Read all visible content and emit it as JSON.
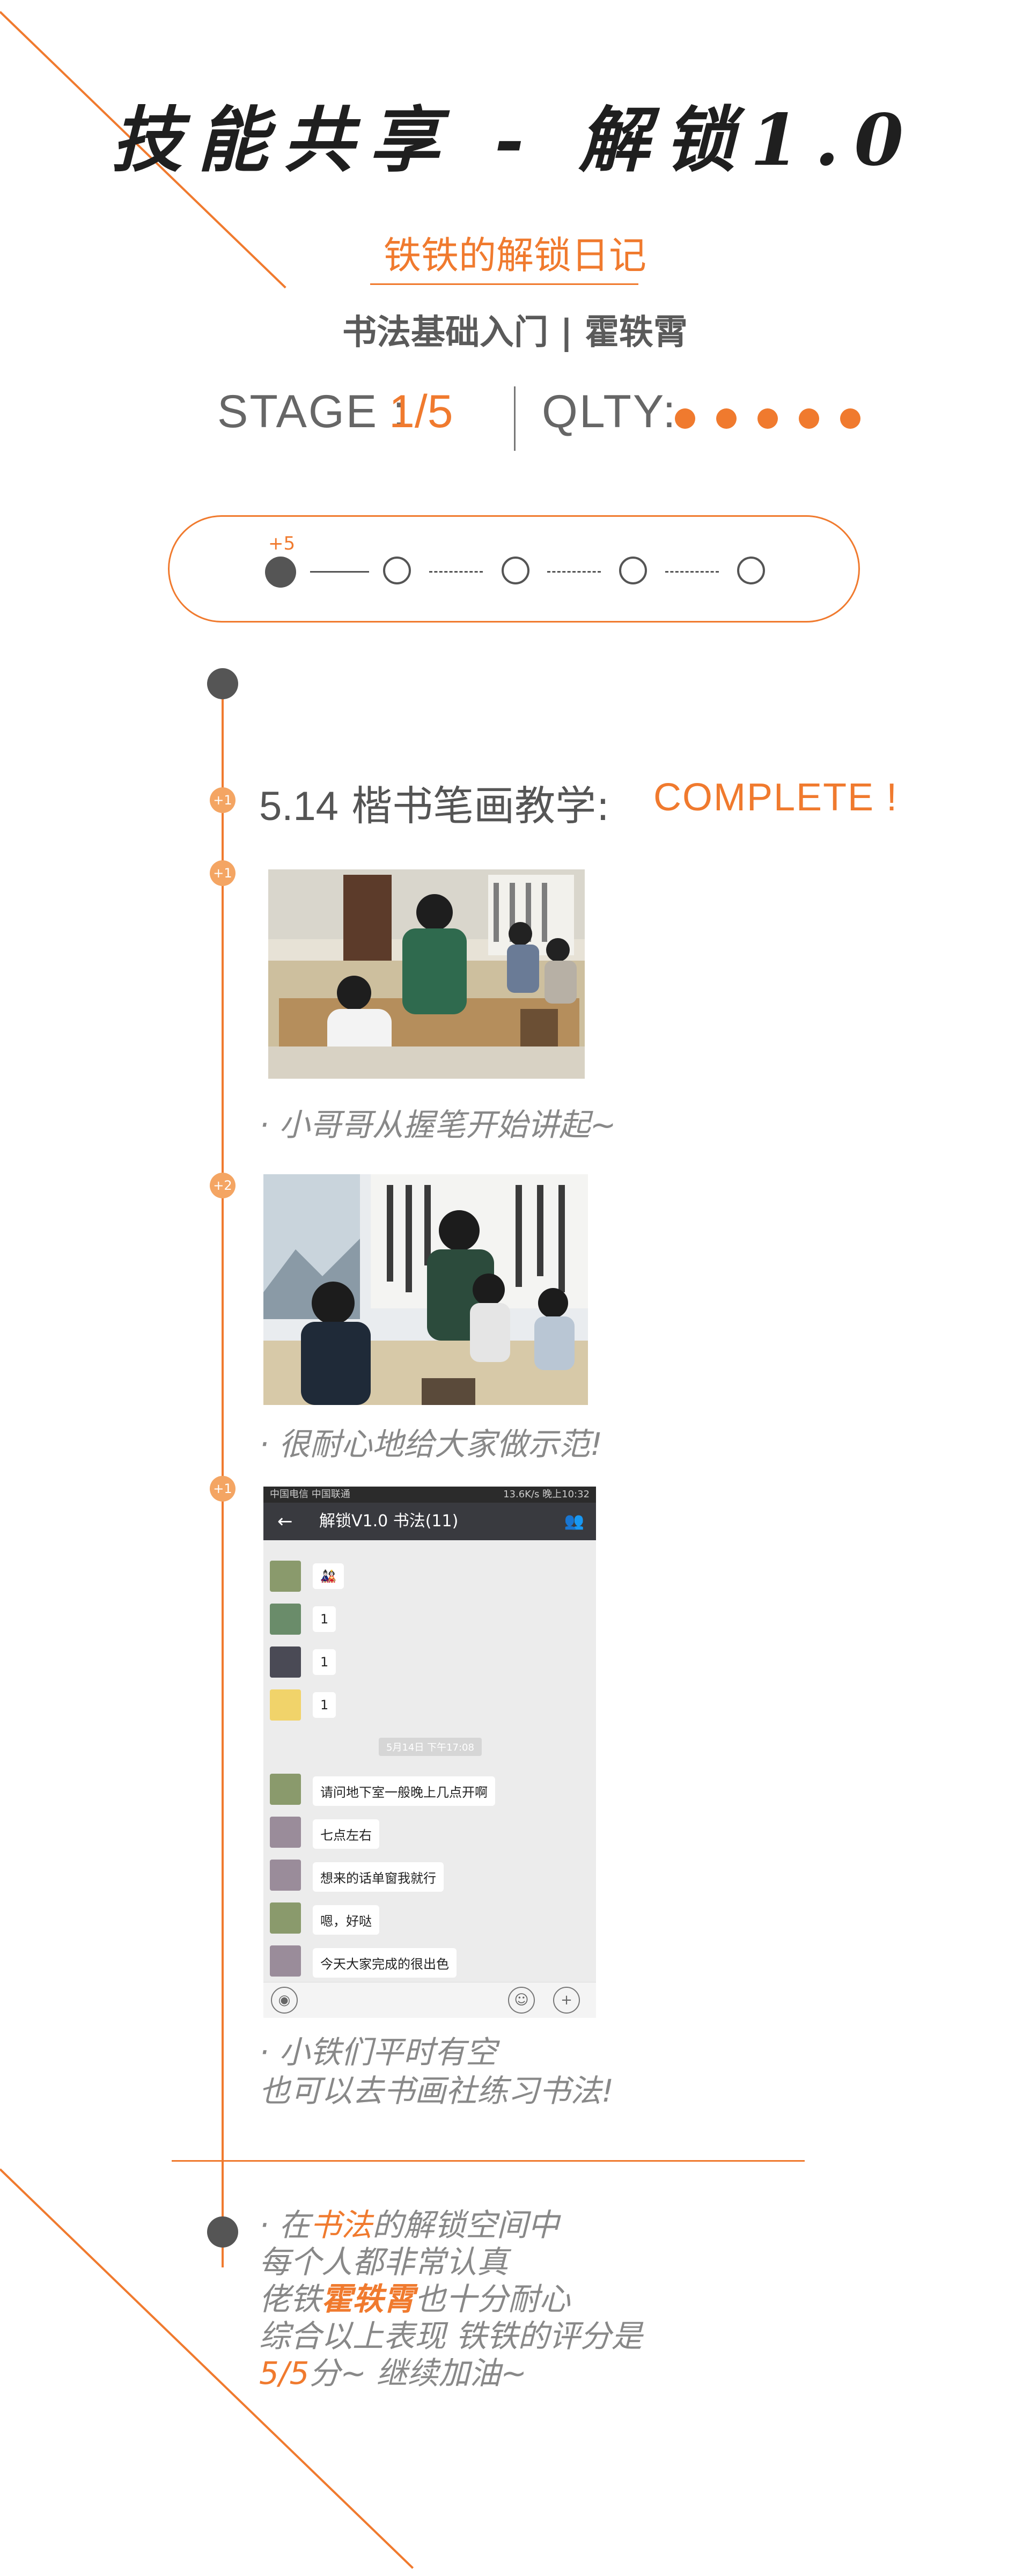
{
  "header": {
    "title": "技能共享 - 解锁1.0",
    "subtitle": "铁铁的解锁日记",
    "course": "书法基础入门 | 霍轶霄"
  },
  "stats": {
    "stage_label": "STAGE :",
    "stage_value": "1/5",
    "quality_label": "QLTY:",
    "quality_score": 5
  },
  "progress": {
    "plus_label": "+5",
    "completed_steps": 1,
    "total_steps": 5
  },
  "section": {
    "date": "5.14",
    "title": "楷书笔画教学:",
    "status": "COMPLETE !"
  },
  "timeline_badges": [
    "+1",
    "+1",
    "+2",
    "+1"
  ],
  "captions": {
    "photo1": "· 小哥哥从握笔开始讲起~",
    "photo2": "· 很耐心地给大家做示范!",
    "chat_line1": "· 小铁们平时有空",
    "chat_line2": "也可以去书画社练习书法!"
  },
  "chat_screenshot": {
    "status_left": "中国电信 中国联通",
    "status_right": "13.6K/s  晚上10:32",
    "title": "解锁V1.0 书法(11)",
    "time_divider": "5月14日 下午17:08",
    "messages": [
      {
        "text": "🎎"
      },
      {
        "text": "1"
      },
      {
        "text": "1"
      },
      {
        "text": "1"
      },
      {
        "text": "请问地下室一般晚上几点开啊"
      },
      {
        "text": "七点左右"
      },
      {
        "text": "想来的话单窗我就行"
      },
      {
        "text": "嗯，好哒"
      },
      {
        "text": "今天大家完成的很出色"
      }
    ]
  },
  "summary": {
    "l1_pre": "· 在",
    "l1_hl": "书法",
    "l1_post": "的解锁空间中",
    "l2": "每个人都非常认真",
    "l3_pre": "佬铁",
    "l3_hl": "霍轶霄",
    "l3_post": "也十分耐心",
    "l4": "综合以上表现 铁铁的评分是",
    "l5_hl": "5/5",
    "l5_post": "分~ 继续加油~"
  },
  "colors": {
    "accent": "#f07a2e",
    "dark": "#555555",
    "text": "#888888"
  }
}
